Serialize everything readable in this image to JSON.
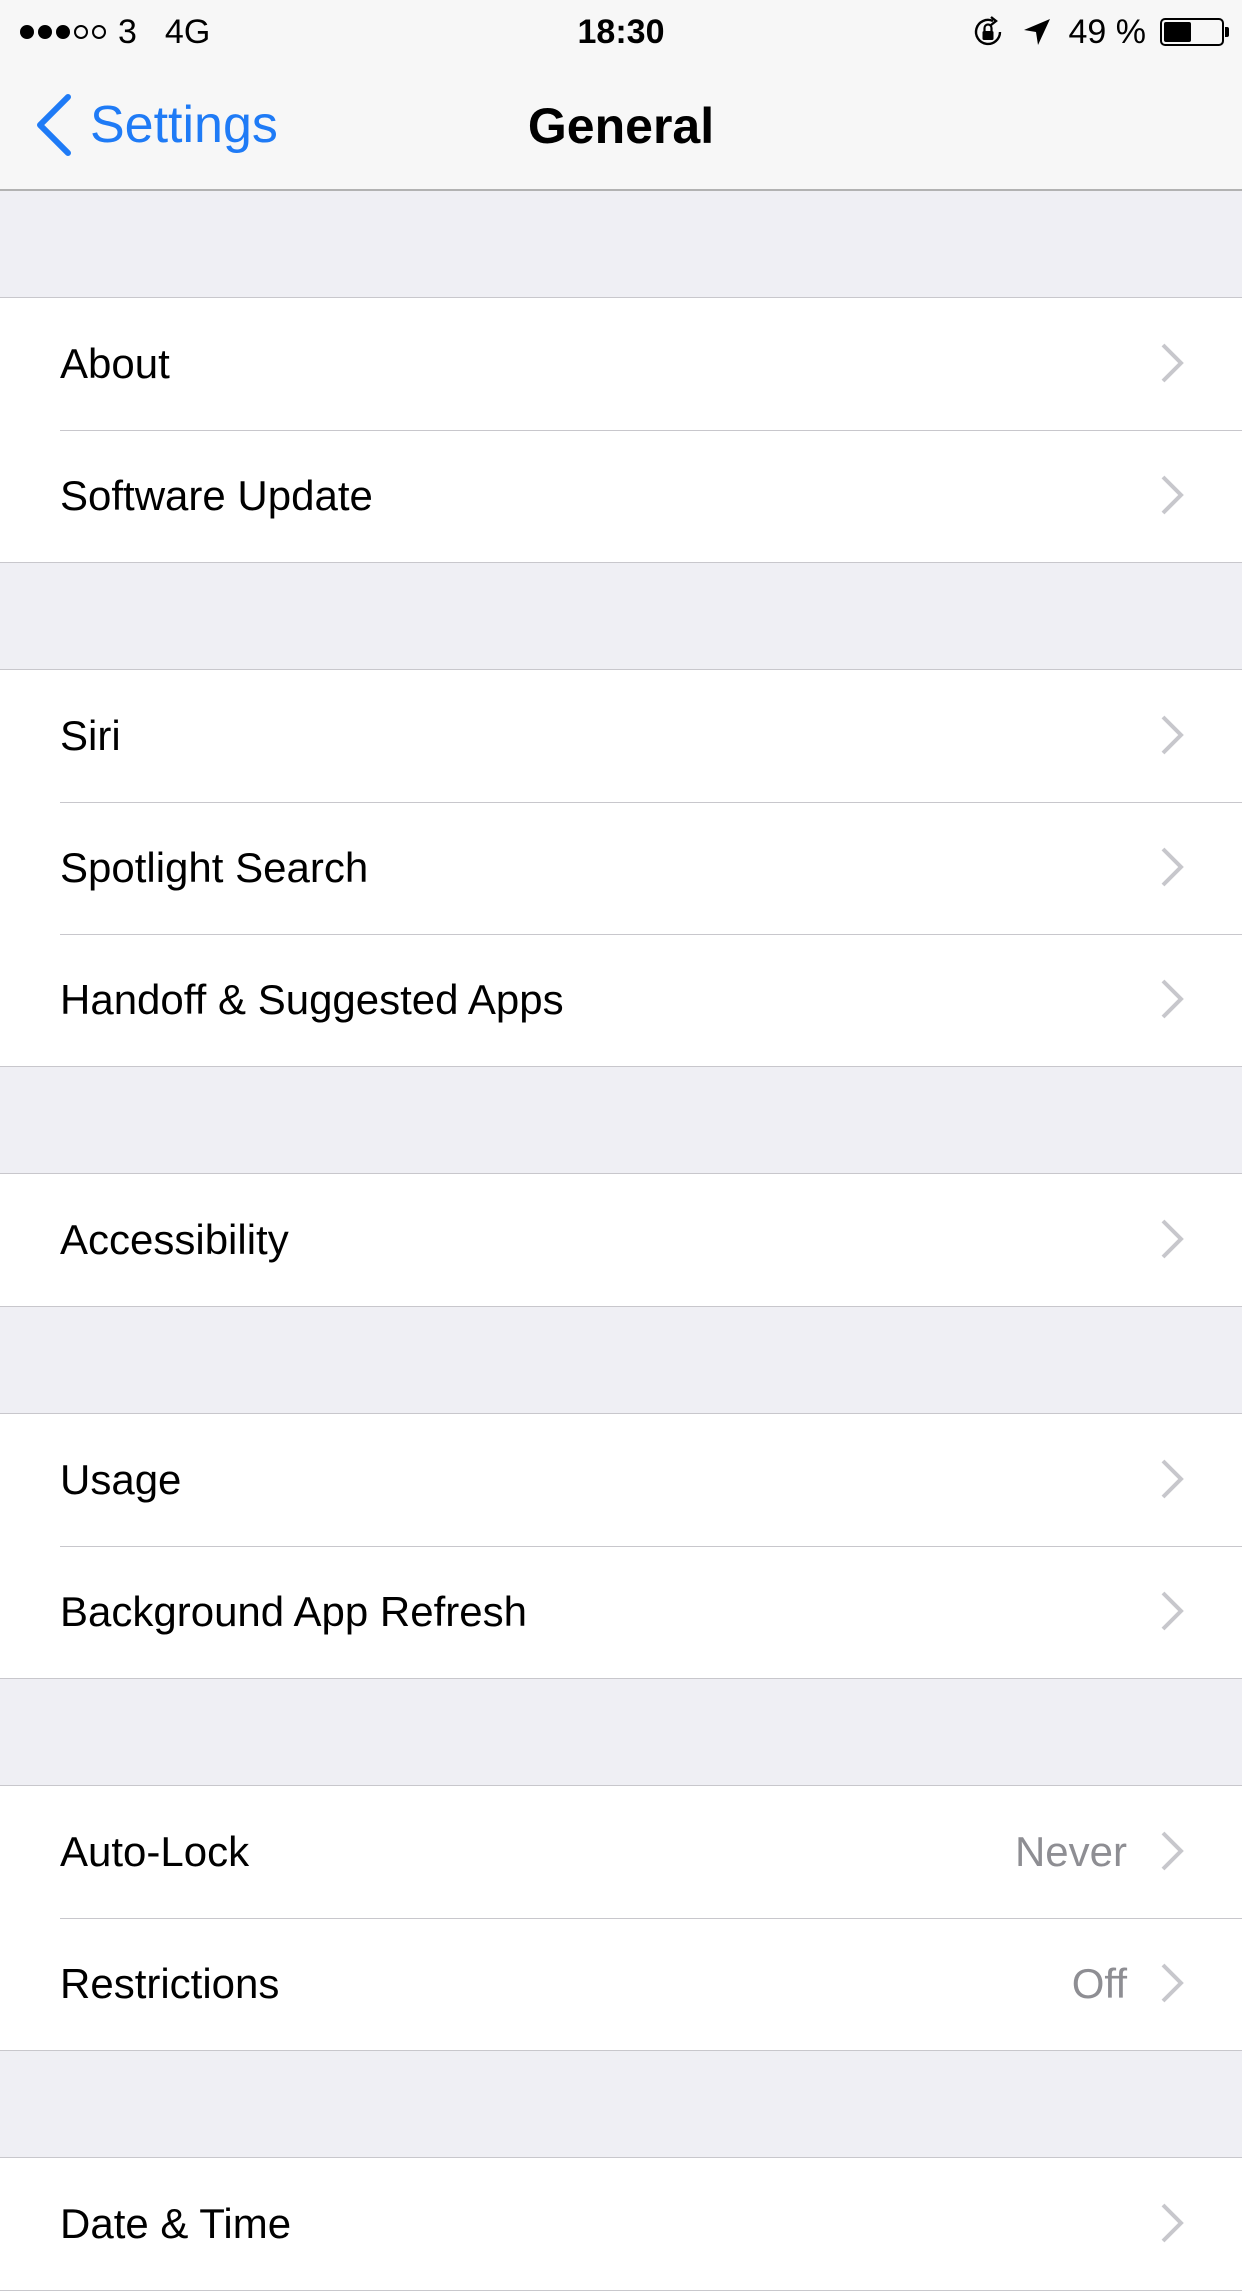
{
  "status_bar": {
    "signal_bars_filled": 3,
    "signal_bars_total": 5,
    "carrier": "3",
    "network": "4G",
    "time": "18:30",
    "battery_percent": "49 %",
    "battery_level": 0.49,
    "icons": [
      "rotation-lock-icon",
      "location-arrow-icon",
      "battery-icon"
    ]
  },
  "nav": {
    "back_label": "Settings",
    "title": "General",
    "accent_color": "#1f7bf6"
  },
  "groups": [
    {
      "rows": [
        {
          "label": "About"
        },
        {
          "label": "Software Update"
        }
      ]
    },
    {
      "rows": [
        {
          "label": "Siri"
        },
        {
          "label": "Spotlight Search"
        },
        {
          "label": "Handoff & Suggested Apps"
        }
      ]
    },
    {
      "rows": [
        {
          "label": "Accessibility"
        }
      ]
    },
    {
      "rows": [
        {
          "label": "Usage"
        },
        {
          "label": "Background App Refresh"
        }
      ]
    },
    {
      "rows": [
        {
          "label": "Auto-Lock",
          "value": "Never"
        },
        {
          "label": "Restrictions",
          "value": "Off"
        }
      ]
    },
    {
      "rows": [
        {
          "label": "Date & Time"
        }
      ]
    }
  ]
}
